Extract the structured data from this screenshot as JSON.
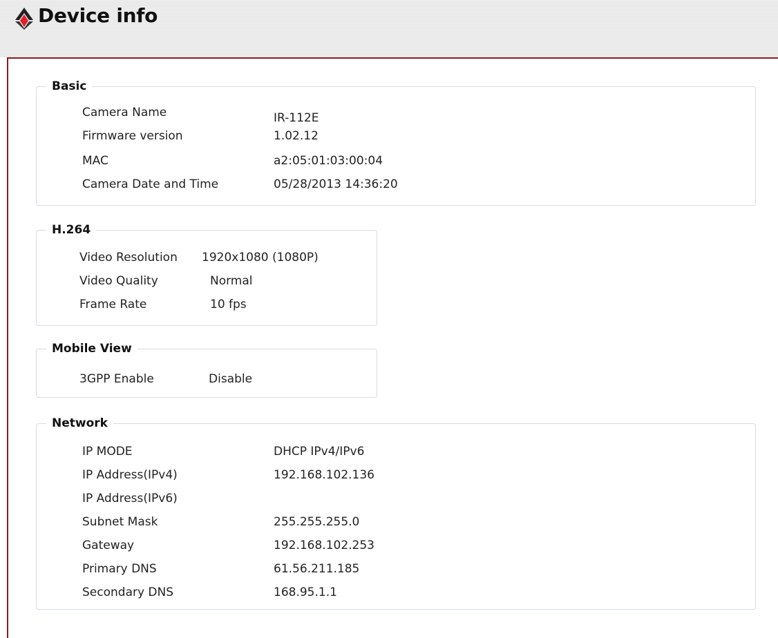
{
  "page_title": "Device info",
  "basic": {
    "legend": "Basic",
    "rows": [
      {
        "label": "Camera Name",
        "value": "IR-112E"
      },
      {
        "label": "Firmware version",
        "value": "1.02.12"
      },
      {
        "label": "MAC",
        "value": "a2:05:01:03:00:04"
      },
      {
        "label": "Camera Date and Time",
        "value": "05/28/2013 14:36:20"
      }
    ]
  },
  "h264": {
    "legend": "H.264",
    "rows": [
      {
        "label": "Video Resolution",
        "value": "1920x1080 (1080P)"
      },
      {
        "label": "Video Quality",
        "value": "Normal"
      },
      {
        "label": "Frame Rate",
        "value": "10 fps"
      }
    ]
  },
  "mobile": {
    "legend": "Mobile View",
    "rows": [
      {
        "label": "3GPP Enable",
        "value": "Disable"
      }
    ]
  },
  "network": {
    "legend": "Network",
    "rows": [
      {
        "label": "IP MODE",
        "value": "DHCP IPv4/IPv6"
      },
      {
        "label": "IP Address(IPv4)",
        "value": "192.168.102.136"
      },
      {
        "label": "IP Address(IPv6)",
        "value": ""
      },
      {
        "label": "Subnet Mask",
        "value": "255.255.255.0"
      },
      {
        "label": "Gateway",
        "value": "192.168.102.253"
      },
      {
        "label": "Primary DNS",
        "value": "61.56.211.185"
      },
      {
        "label": "Secondary DNS",
        "value": "168.95.1.1"
      }
    ]
  },
  "colors": {
    "accent_border": "#8b1a1a",
    "logo_red": "#e0202a",
    "group_border": "#d4dde6"
  },
  "icons": {
    "logo": "device-logo-icon"
  }
}
